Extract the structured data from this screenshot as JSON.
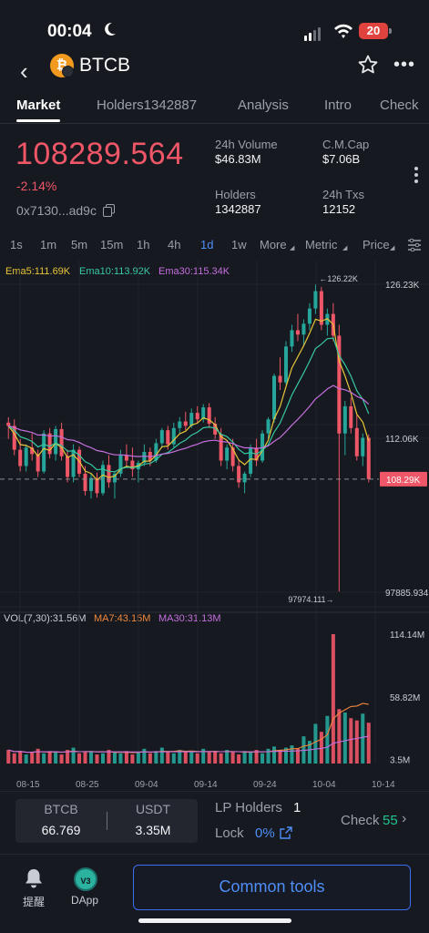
{
  "status_bar": {
    "time": "00:04",
    "battery": "20"
  },
  "header": {
    "title": "BTCB",
    "coin_glyph": "₿"
  },
  "tabs": [
    {
      "label": "Market",
      "active": true
    },
    {
      "label": "Holders1342887",
      "active": false
    },
    {
      "label": "Analysis",
      "active": false
    },
    {
      "label": "Intro",
      "active": false
    },
    {
      "label": "Check",
      "active": false
    }
  ],
  "summary": {
    "price": "108289.564",
    "change": "-2.14%",
    "address": "0x7130...ad9c",
    "volume_label": "24h Volume",
    "volume_value": "$46.83M",
    "mcap_label": "C.M.Cap",
    "mcap_value": "$7.06B",
    "holders_label": "Holders",
    "holders_value": "1342887",
    "txs_label": "24h Txs",
    "txs_value": "12152"
  },
  "timeframes": [
    {
      "label": "1s",
      "active": false
    },
    {
      "label": "1m",
      "active": false
    },
    {
      "label": "5m",
      "active": false
    },
    {
      "label": "15m",
      "active": false
    },
    {
      "label": "1h",
      "active": false
    },
    {
      "label": "4h",
      "active": false
    },
    {
      "label": "1d",
      "active": true
    },
    {
      "label": "1w",
      "active": false
    },
    {
      "label": "More",
      "active": false
    },
    {
      "label": "Metric",
      "active": false
    },
    {
      "label": "Price",
      "active": false
    }
  ],
  "chart_data": {
    "type": "candlestick",
    "ema_legend": [
      {
        "text": "Ema5:111.69K",
        "color": "#e8c53a"
      },
      {
        "text": "Ema10:113.92K",
        "color": "#36c9a0"
      },
      {
        "text": "Ema30:115.34K",
        "color": "#c56fe0"
      }
    ],
    "price_axis_labels": [
      "126.23K",
      "112.06K",
      "97885.934"
    ],
    "price_range": [
      97885.934,
      126230
    ],
    "high_label": "←126.22K",
    "low_label": "97974.111→",
    "last_price_tag": "108.29K",
    "vol_legend": [
      {
        "text": "VOL(7,30):31.56M",
        "color": "#c9ccd3"
      },
      {
        "text": "MA7:43.15M",
        "color": "#f0883e"
      },
      {
        "text": "MA30:31.13M",
        "color": "#c56fe0"
      }
    ],
    "volume_axis_labels": [
      "114.14M",
      "58.82M",
      "3.5M"
    ],
    "volume_range": [
      3.5,
      114.14
    ],
    "x_dates": [
      "08-15",
      "08-25",
      "09-04",
      "09-14",
      "09-24",
      "10-04",
      "10-14"
    ],
    "candles": [
      [
        113.5,
        114.0,
        112.0,
        113.2
      ],
      [
        113.2,
        113.8,
        110.5,
        111.0
      ],
      [
        111.0,
        112.0,
        109.0,
        109.5
      ],
      [
        109.5,
        111.5,
        109.0,
        111.2
      ],
      [
        111.2,
        112.5,
        110.0,
        110.6
      ],
      [
        110.6,
        111.0,
        108.5,
        109.0
      ],
      [
        109.0,
        112.8,
        108.8,
        112.5
      ],
      [
        112.5,
        113.0,
        110.2,
        110.6
      ],
      [
        110.6,
        113.2,
        110.0,
        112.9
      ],
      [
        112.9,
        113.5,
        110.0,
        110.4
      ],
      [
        110.4,
        111.0,
        108.0,
        108.5
      ],
      [
        108.5,
        111.5,
        108.0,
        111.0
      ],
      [
        111.0,
        111.3,
        108.5,
        108.8
      ],
      [
        108.8,
        109.5,
        106.8,
        107.2
      ],
      [
        107.2,
        108.8,
        106.5,
        108.4
      ],
      [
        108.4,
        108.9,
        106.6,
        107.0
      ],
      [
        107.0,
        110.0,
        106.8,
        109.6
      ],
      [
        109.6,
        110.5,
        107.5,
        108.0
      ],
      [
        108.0,
        109.0,
        106.5,
        108.8
      ],
      [
        108.8,
        111.0,
        108.5,
        110.5
      ],
      [
        110.5,
        111.5,
        109.5,
        110.0
      ],
      [
        110.0,
        111.2,
        108.5,
        109.2
      ],
      [
        109.2,
        110.0,
        108.0,
        109.8
      ],
      [
        109.8,
        111.5,
        109.5,
        110.8
      ],
      [
        110.8,
        111.2,
        109.5,
        110.0
      ],
      [
        110.0,
        112.0,
        109.8,
        111.6
      ],
      [
        111.6,
        113.0,
        111.2,
        112.8
      ],
      [
        112.8,
        113.2,
        111.0,
        111.5
      ],
      [
        111.5,
        113.5,
        111.2,
        113.0
      ],
      [
        113.0,
        114.0,
        112.5,
        113.6
      ],
      [
        113.6,
        114.5,
        112.8,
        113.2
      ],
      [
        113.2,
        114.8,
        113.0,
        114.4
      ],
      [
        114.4,
        115.0,
        113.5,
        113.8
      ],
      [
        113.8,
        115.2,
        113.5,
        114.9
      ],
      [
        114.9,
        115.3,
        113.0,
        113.4
      ],
      [
        113.4,
        114.0,
        112.0,
        112.4
      ],
      [
        112.4,
        113.0,
        109.5,
        110.0
      ],
      [
        110.0,
        111.5,
        109.2,
        111.2
      ],
      [
        111.2,
        112.0,
        109.0,
        109.5
      ],
      [
        109.5,
        110.0,
        107.5,
        108.0
      ],
      [
        108.0,
        109.0,
        107.0,
        108.8
      ],
      [
        108.8,
        111.5,
        108.5,
        111.2
      ],
      [
        111.2,
        112.0,
        109.5,
        110.0
      ],
      [
        110.0,
        112.8,
        109.8,
        112.5
      ],
      [
        112.5,
        114.0,
        112.0,
        113.8
      ],
      [
        113.8,
        118.0,
        113.5,
        117.8
      ],
      [
        117.8,
        119.5,
        116.5,
        117.2
      ],
      [
        117.2,
        121.0,
        117.0,
        120.5
      ],
      [
        120.5,
        122.5,
        120.0,
        122.0
      ],
      [
        122.0,
        123.5,
        121.0,
        121.6
      ],
      [
        121.6,
        123.0,
        120.5,
        122.6
      ],
      [
        122.6,
        124.5,
        122.0,
        124.0
      ],
      [
        124.0,
        126.2,
        123.5,
        125.6
      ],
      [
        125.6,
        126.0,
        122.0,
        122.5
      ],
      [
        122.5,
        124.0,
        121.5,
        123.5
      ],
      [
        123.5,
        124.5,
        121.0,
        121.5
      ],
      [
        121.5,
        122.5,
        97.97,
        112.5
      ],
      [
        112.5,
        115.5,
        110.5,
        115.0
      ],
      [
        115.0,
        115.8,
        112.5,
        113.0
      ],
      [
        113.0,
        114.2,
        110.0,
        110.4
      ],
      [
        110.4,
        112.5,
        109.5,
        112.1
      ],
      [
        112.1,
        112.4,
        108.0,
        108.3
      ]
    ],
    "volumes": [
      12,
      9,
      11,
      8,
      10,
      13,
      9,
      11,
      10,
      8,
      12,
      14,
      9,
      10,
      11,
      8,
      9,
      12,
      10,
      9,
      11,
      8,
      10,
      13,
      9,
      11,
      14,
      10,
      9,
      12,
      11,
      10,
      9,
      13,
      10,
      11,
      9,
      12,
      10,
      8,
      11,
      10,
      12,
      9,
      13,
      15,
      12,
      14,
      16,
      13,
      24,
      20,
      35,
      28,
      42,
      114.14,
      48,
      45,
      40,
      38,
      44,
      36
    ]
  },
  "pair": {
    "base_label": "BTCB",
    "base_value": "66.769",
    "quote_label": "USDT",
    "quote_value": "3.35M"
  },
  "lp": {
    "holders_label": "LP Holders",
    "holders_value": "1",
    "lock_label": "Lock",
    "lock_value": "0%",
    "check_label": "Check",
    "check_count": "55"
  },
  "bottom_nav": {
    "alert_label": "提醒",
    "dapp_label": "DApp",
    "dapp_badge": "V3",
    "tools_label": "Common tools"
  },
  "colors": {
    "up": "#26a69a",
    "down": "#ef5667",
    "accent": "#4f8ef7"
  }
}
